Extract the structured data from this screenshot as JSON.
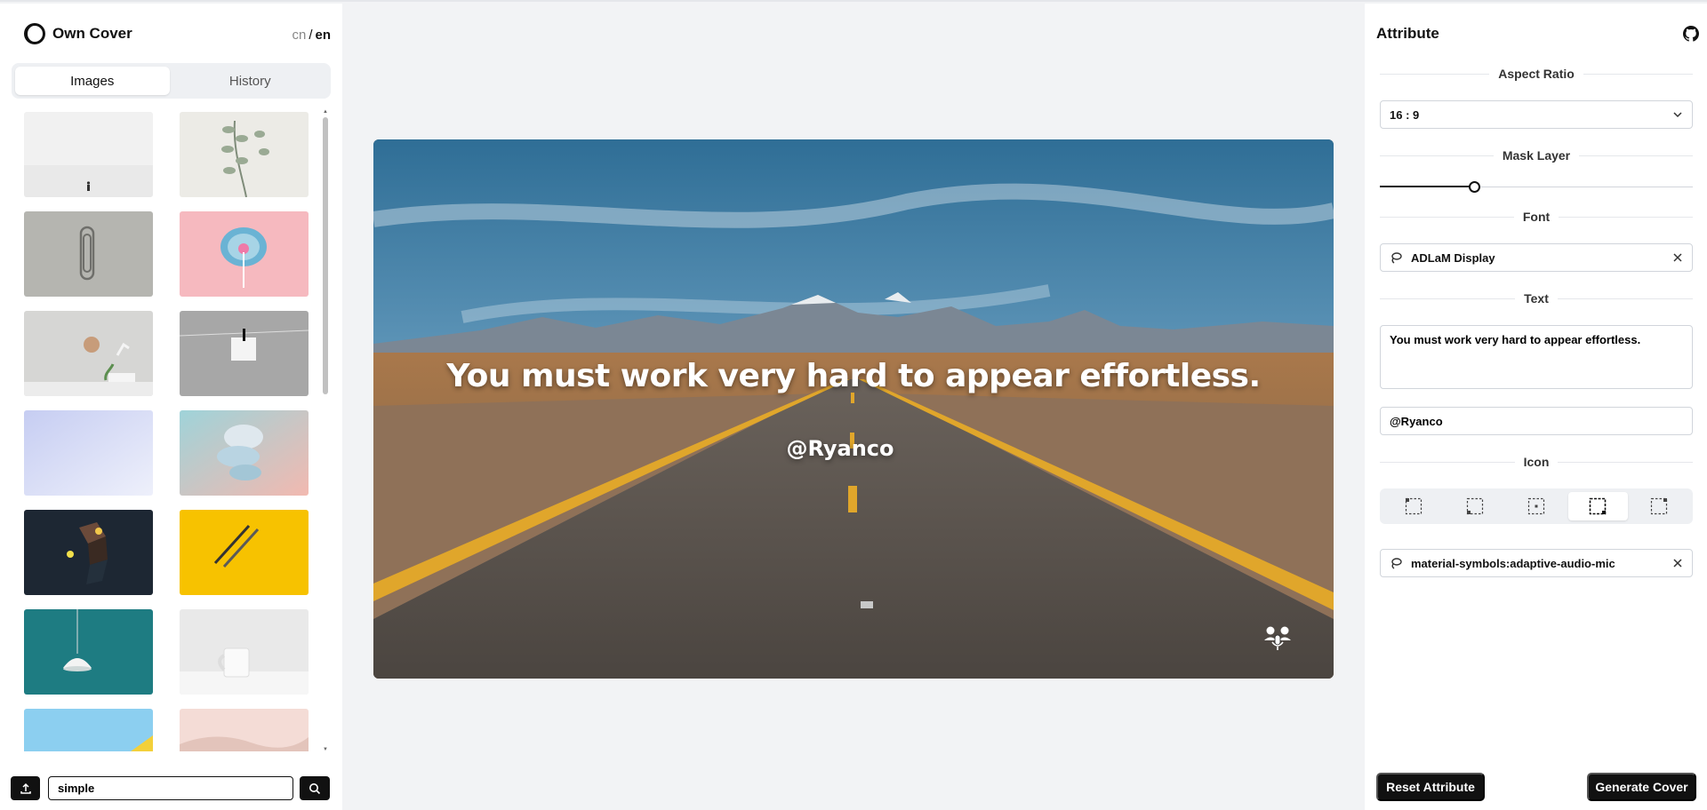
{
  "brand": {
    "name": "Own Cover"
  },
  "lang": {
    "cn": "cn",
    "sep": "/",
    "en": "en"
  },
  "left_tabs": [
    {
      "label": "Images"
    },
    {
      "label": "History"
    }
  ],
  "gallery": {
    "images": [
      "misty-snow-figure",
      "eucalyptus-branch",
      "paperclip-on-grey",
      "pink-lollipop",
      "wall-clock-desk",
      "paper-on-string",
      "lavender-gradient",
      "abstract-3d-discs",
      "dark-3d-cubes",
      "pencils-on-yellow",
      "teal-pendant-lamp",
      "white-mug",
      "sky-blue-yellow-corner",
      "pink-desert-dunes"
    ]
  },
  "search": {
    "value": "simple"
  },
  "cover": {
    "title": "You must work very hard to appear effortless.",
    "author": "@Ryanco",
    "icon": "adaptive-audio-mic-icon"
  },
  "attribute": {
    "title": "Attribute",
    "sections": {
      "aspect_ratio": "Aspect Ratio",
      "mask_layer": "Mask Layer",
      "font": "Font",
      "text": "Text",
      "icon": "Icon"
    },
    "aspect_ratio_value": "16 : 9",
    "mask_layer_value": 0.3,
    "font_value": "ADLaM Display",
    "text_value": "You must work very hard to appear effortless.",
    "author_value": "@Ryanco",
    "icon_positions": [
      "top-left",
      "bottom-left",
      "center",
      "bottom-center",
      "right"
    ],
    "icon_position_selected": 3,
    "icon_value": "material-symbols:adaptive-audio-mic",
    "reset_label": "Reset Attribute",
    "generate_label": "Generate Cover"
  }
}
